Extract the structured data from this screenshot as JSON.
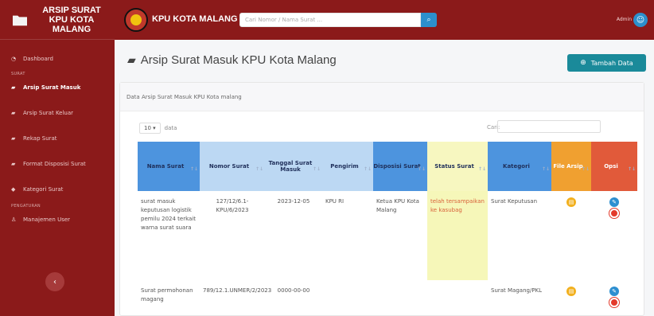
{
  "sidebar": {
    "brand": "ARSIP SURAT KPU KOTA MALANG",
    "heading1": "SURAT",
    "heading2": "PENGATURAN",
    "dashboard": "Dashboard",
    "items": [
      {
        "label": "Arsip Surat Masuk"
      },
      {
        "label": "Arsip Surat Keluar"
      },
      {
        "label": "Rekap Surat"
      },
      {
        "label": "Format Disposisi Surat"
      },
      {
        "label": "Kategori Surat"
      }
    ],
    "manage_users": "Manajemen User"
  },
  "topbar": {
    "title": "KPU KOTA MALANG",
    "search_placeholder": "Cari Nomor / Nama Surat ...",
    "admin_name": "Admin"
  },
  "main": {
    "page_title": "Arsip Surat Masuk KPU Kota Malang",
    "add_button": "Tambah Data",
    "card_title": "Data Arsip Surat Masuk KPU Kota malang",
    "length_value": "10",
    "length_suffix": "data",
    "search_label": "Cari:",
    "columns": [
      "Nama Surat",
      "Nomor Surat",
      "Tanggal Surat Masuk",
      "Pengirim",
      "Disposisi Surat",
      "Status Surat",
      "Kategori",
      "File Arsip",
      "Opsi"
    ],
    "rows": [
      {
        "nama": "surat masuk keputusan logistik pemilu 2024 terkait warna surat suara",
        "nomor": "127/12/6.1-KPU/6/2023",
        "tanggal": "2023-12-05",
        "pengirim": "KPU RI",
        "disposisi": "Ketua KPU Kota Malang",
        "status": "telah tersampaikan ke kasubag",
        "kategori": "Surat Keputusan"
      },
      {
        "nama": "Surat permohonan magang",
        "nomor": "789/12.1.UNMER/2/2023",
        "tanggal": "0000-00-00",
        "pengirim": "",
        "disposisi": "",
        "status": "",
        "kategori": "Surat Magang/PKL"
      }
    ]
  },
  "colors": {
    "sidebar_bg": "#8b1a1a",
    "header_blue": "#4d94de",
    "header_light": "#bcd8f3",
    "status_yellow": "#f7f7c0",
    "file_orange": "#f0a030",
    "opsi_red": "#e15a3a",
    "accent_teal": "#1a8a9a"
  }
}
